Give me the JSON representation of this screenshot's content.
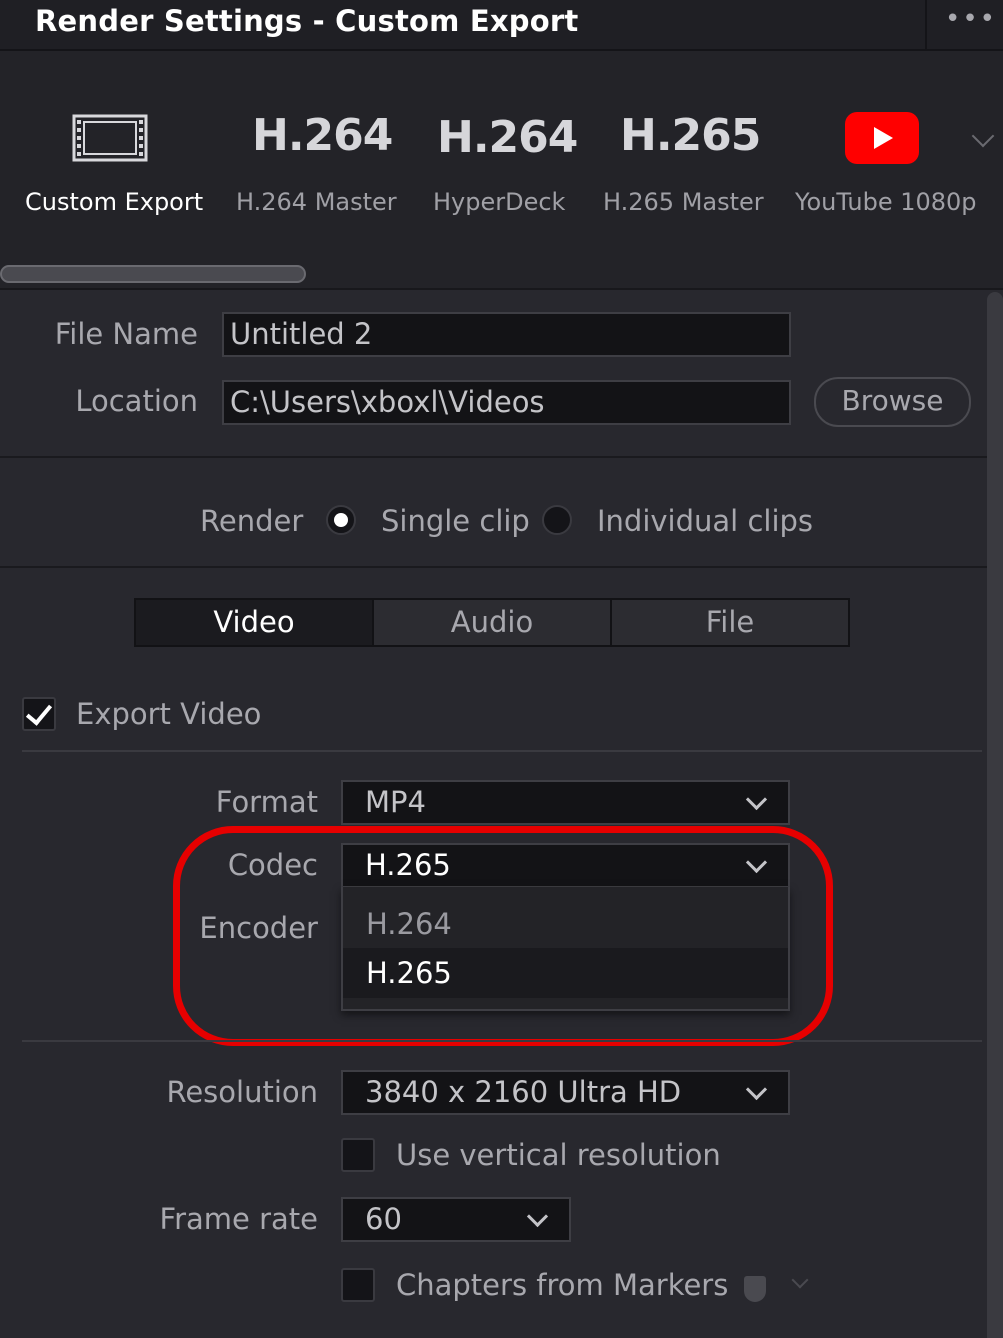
{
  "window": {
    "title": "Render Settings - Custom Export",
    "menu_icon": "more-icon"
  },
  "presets": [
    {
      "icon": "film-strip-icon",
      "label": "Custom Export",
      "selected": true
    },
    {
      "codec_text": "H.264",
      "label": "H.264 Master"
    },
    {
      "codec_text": "H.264",
      "label": "HyperDeck"
    },
    {
      "codec_text": "H.265",
      "label": "H.265 Master"
    },
    {
      "icon": "youtube-icon",
      "label": "YouTube 1080p",
      "color": "#ff0000"
    }
  ],
  "file": {
    "name_label": "File Name",
    "name_value": "Untitled 2",
    "location_label": "Location",
    "location_value": "C:\\Users\\xboxl\\Videos",
    "browse_label": "Browse"
  },
  "render": {
    "label": "Render",
    "options": [
      {
        "label": "Single clip",
        "selected": true
      },
      {
        "label": "Individual clips",
        "selected": false
      }
    ]
  },
  "tabs": [
    {
      "label": "Video",
      "active": true
    },
    {
      "label": "Audio",
      "active": false
    },
    {
      "label": "File",
      "active": false
    }
  ],
  "export_video": {
    "label": "Export Video",
    "checked": true
  },
  "video": {
    "format_label": "Format",
    "format_value": "MP4",
    "codec_label": "Codec",
    "codec_value": "H.265",
    "encoder_label": "Encoder",
    "codec_options": [
      {
        "label": "H.264",
        "selected": false
      },
      {
        "label": "H.265",
        "selected": true
      }
    ],
    "resolution_label": "Resolution",
    "resolution_value": "3840 x 2160 Ultra HD",
    "vertical_label": "Use vertical resolution",
    "vertical_checked": false,
    "framerate_label": "Frame rate",
    "framerate_value": "60",
    "chapters_label": "Chapters from Markers",
    "chapters_checked": false
  },
  "highlight_color": "#e60000"
}
